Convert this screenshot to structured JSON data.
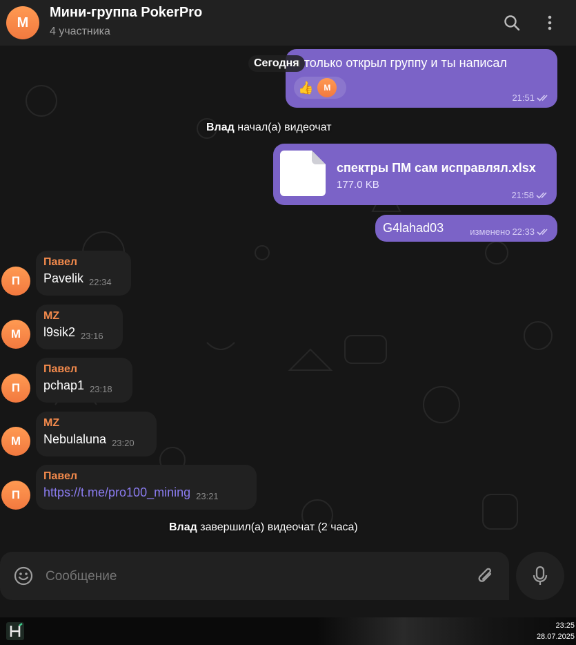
{
  "header": {
    "avatar_letter": "М",
    "title": "Мини-группа PokerPro",
    "subtitle": "4 участника",
    "icons": [
      "search-icon",
      "more-vertical-icon"
    ]
  },
  "chat": {
    "date_pill": "Сегодня",
    "messages_out": [
      {
        "text": "я только открыл группу и ты написал",
        "time": "21:51",
        "reactions": [
          "👍",
          "М"
        ]
      },
      {
        "file_name": "спектры ПМ сам исправлял.xlsx",
        "file_size": "177.0 KB",
        "time": "21:58"
      },
      {
        "text": "G4lahad03",
        "edited": "изменено",
        "time": "22:33"
      }
    ],
    "service": [
      {
        "name": "Влад",
        "text": " начал(а) видеочат"
      },
      {
        "name": "Влад",
        "text": " завершил(а) видеочат (2 часа)"
      }
    ],
    "messages_in": [
      {
        "avatar": "П",
        "sender": "Павел",
        "text": "Pavelik",
        "time": "22:34"
      },
      {
        "avatar": "М",
        "sender": "MZ",
        "text": "l9sik2",
        "time": "23:16"
      },
      {
        "avatar": "П",
        "sender": "Павел",
        "text": "pchap1",
        "time": "23:18"
      },
      {
        "avatar": "М",
        "sender": "MZ",
        "text": "Nebulaluna",
        "time": "23:20"
      },
      {
        "avatar": "П",
        "sender": "Павел",
        "text": "https://t.me/pro100_mining",
        "time": "23:21"
      }
    ]
  },
  "composer": {
    "placeholder": "Сообщение",
    "icons": [
      "emoji-icon",
      "attach-icon",
      "mic-icon"
    ]
  },
  "taskbar": {
    "time": "23:25",
    "date": "28.07.2025",
    "app_icon": "app-logo-icon"
  },
  "colors": {
    "accent_out": "#7b63c7",
    "sender_name": "#f38a4c",
    "link": "#8b7cf0",
    "panel": "#212121"
  }
}
